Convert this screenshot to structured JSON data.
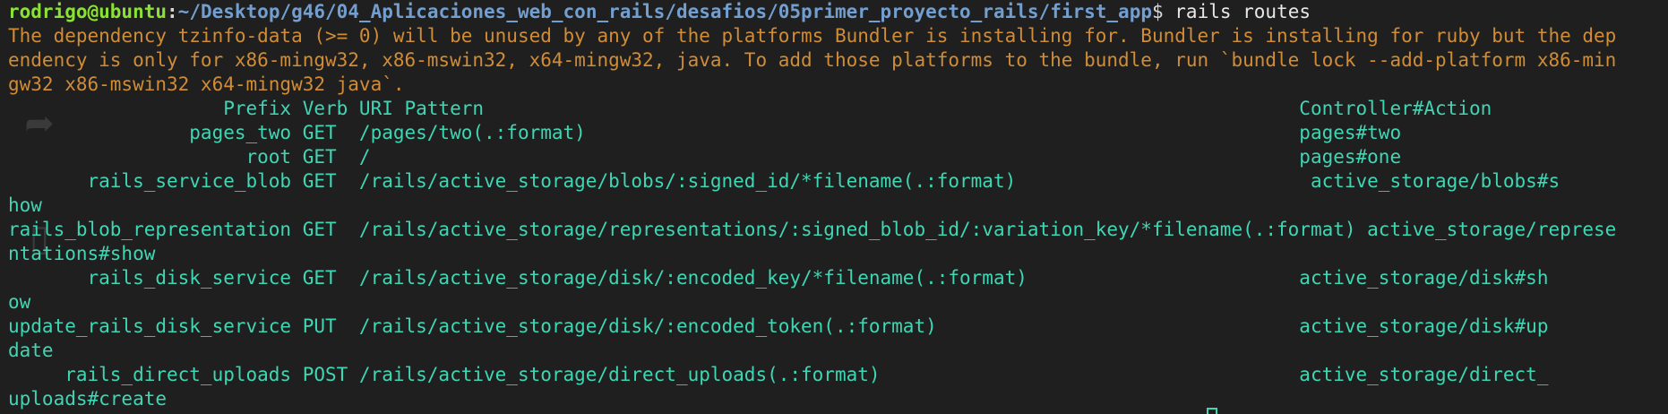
{
  "prompt": {
    "user_host": "rodrigo@ubuntu",
    "separator": ":",
    "path": "~/Desktop/g46/04_Aplicaciones_web_con_rails/desafios/05primer_proyecto_rails/first_app",
    "symbol": "$ ",
    "command": "rails routes"
  },
  "warning": [
    "The dependency tzinfo-data (>= 0) will be unused by any of the platforms Bundler is installing for. Bundler is installing for ruby but the dep",
    "endency is only for x86-mingw32, x86-mswin32, x64-mingw32, java. To add those platforms to the bundle, run `bundle lock --add-platform x86-min",
    "gw32 x86-mswin32 x64-mingw32 java`."
  ],
  "routes_output": [
    "                   Prefix Verb URI Pattern                                                                        Controller#Action",
    "                pages_two GET  /pages/two(.:format)                                                               pages#two",
    "                     root GET  /                                                                                  pages#one",
    "       rails_service_blob GET  /rails/active_storage/blobs/:signed_id/*filename(.:format)                          active_storage/blobs#s",
    "how",
    "rails_blob_representation GET  /rails/active_storage/representations/:signed_blob_id/:variation_key/*filename(.:format) active_storage/represe",
    "ntations#show",
    "       rails_disk_service GET  /rails/active_storage/disk/:encoded_key/*filename(.:format)                        active_storage/disk#sh",
    "ow",
    "update_rails_disk_service PUT  /rails/active_storage/disk/:encoded_token(.:format)                                active_storage/disk#up",
    "date",
    "     rails_direct_uploads POST /rails/active_storage/direct_uploads(.:format)                                     active_storage/direct_",
    "uploads#create"
  ],
  "colors": {
    "background": "#1f1f1f",
    "prompt_user": "#8ae234",
    "prompt_path": "#729fcf",
    "warning_text": "#d08c36",
    "routes_text": "#3fd6b4"
  },
  "icons": {
    "ghost_1": "share-icon",
    "ghost_2": "device-icon"
  }
}
